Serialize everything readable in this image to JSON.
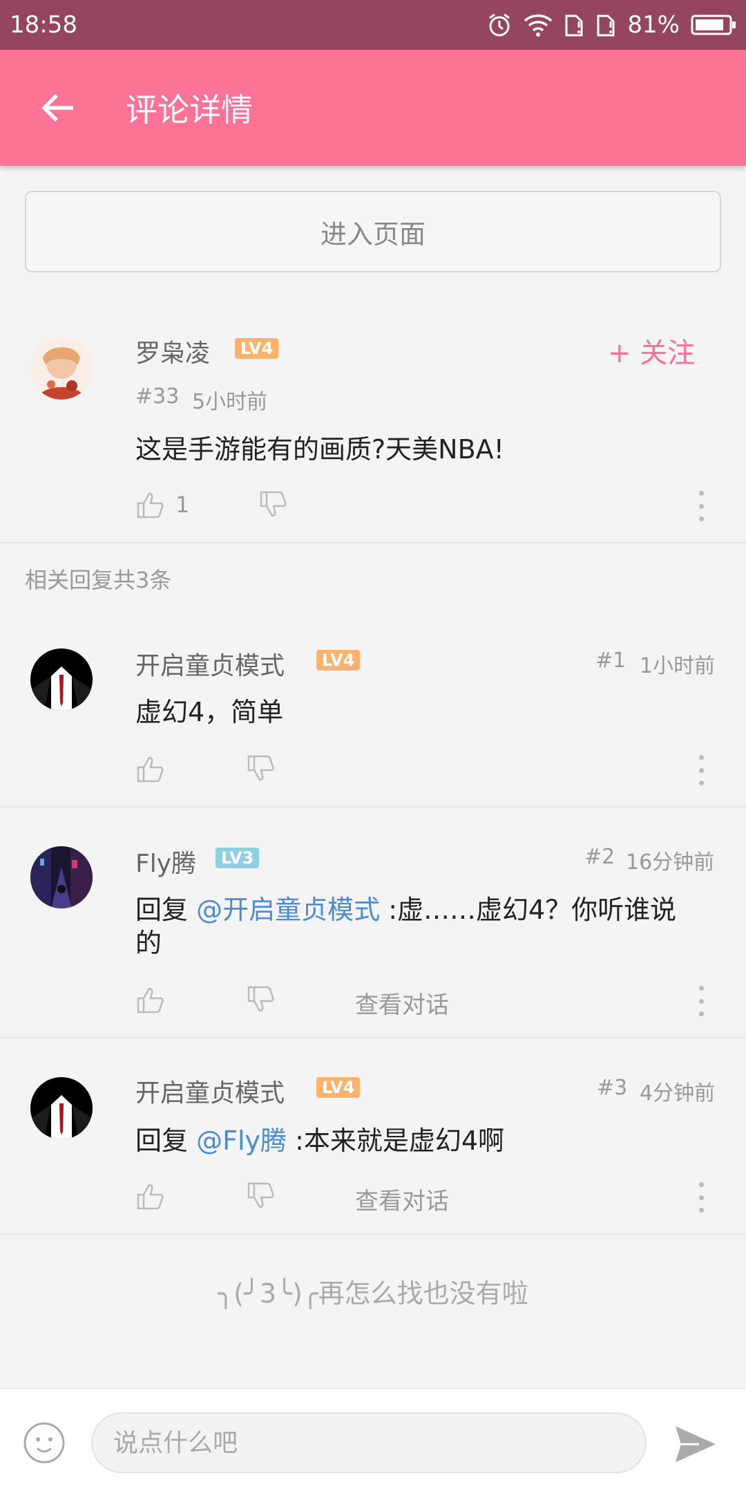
{
  "status_bar": {
    "time": "18:58",
    "battery": "81%",
    "icons": [
      "alarm-icon",
      "wifi-icon",
      "sim1-icon",
      "sim2-icon",
      "battery-icon"
    ]
  },
  "app_bar": {
    "title": "评论详情",
    "back_icon": "arrow-left-icon"
  },
  "enter_page_label": "进入页面",
  "main_comment": {
    "user": "罗枭凌",
    "level": "LV4",
    "floor": "#33",
    "time": "5小时前",
    "text": "这是手游能有的画质?天美NBA!",
    "likes": "1",
    "follow_label": "+ 关注"
  },
  "replies_label": "相关回复共3条",
  "replies": [
    {
      "user": "开启童贞模式",
      "level": "LV4",
      "floor": "#1",
      "time": "1小时前",
      "text": "虚幻4，简单"
    },
    {
      "user": "Fly腾",
      "level": "LV3",
      "floor": "#2",
      "time": "16分钟前",
      "reply_prefix": "回复 ",
      "mention": "@开启童贞模式",
      "text_line1": " :虚……虚幻4？你听谁说",
      "text_line2": "的",
      "view_conversation": "查看对话"
    },
    {
      "user": "开启童贞模式",
      "level": "LV4",
      "floor": "#3",
      "time": "4分钟前",
      "reply_prefix": "回复 ",
      "mention": "@Fly腾",
      "text": " :本来就是虚幻4啊",
      "view_conversation": "查看对话"
    }
  ],
  "end_message": "╮(╯3╰)╭再怎么找也没有啦",
  "input": {
    "placeholder": "说点什么吧"
  },
  "colors": {
    "accent": "#fc7396",
    "status_bar": "#964560",
    "mention": "#4a8cd1",
    "lv4": "#ffb26e",
    "lv3": "#8fd1e4"
  }
}
